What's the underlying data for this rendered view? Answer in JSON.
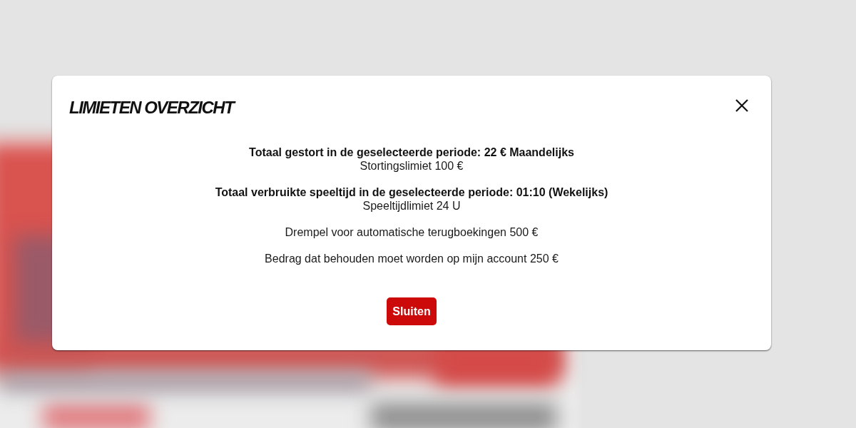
{
  "dialog": {
    "title": "LIMIETEN OVERZICHT",
    "sections": [
      {
        "heading": "Totaal gestort in de geselecteerde periode: 22 € Maandelijks",
        "detail": "Stortingslimiet 100 €"
      },
      {
        "heading": "Totaal verbruikte speeltijd in de geselecteerde periode: 01:10 (Wekelijks)",
        "detail": "Speeltijdlimiet 24 U"
      }
    ],
    "notes": [
      "Drempel voor automatische terugboekingen 500 €",
      "Bedrag dat behouden moet worden op mijn account 250 €"
    ],
    "button": "Sluiten"
  }
}
